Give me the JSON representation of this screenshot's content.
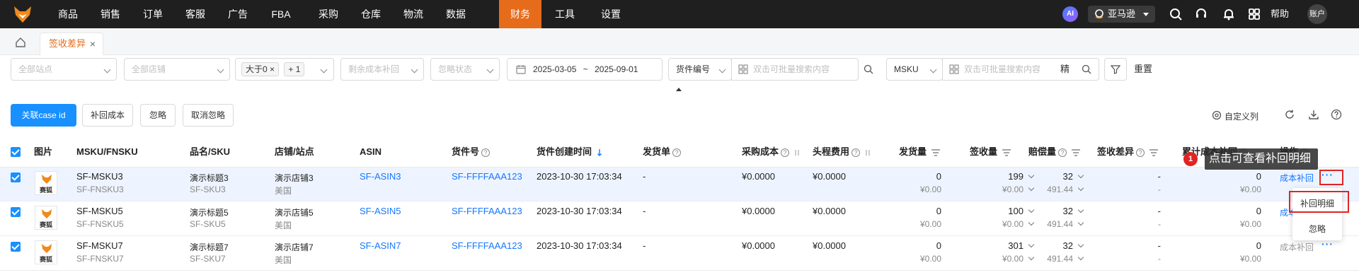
{
  "nav": {
    "items": [
      "商品",
      "销售",
      "订单",
      "客服",
      "广告",
      "FBA",
      "采购",
      "仓库",
      "物流",
      "数据",
      "财务",
      "工具",
      "设置"
    ],
    "active": "财务",
    "ai_label": "AI",
    "marketplace": "亚马逊",
    "help": "帮助",
    "account": "账户",
    "accent": "#e66b1a"
  },
  "tabs": {
    "active_label": "签收差异",
    "close": "×"
  },
  "filters": {
    "site_placeholder": "全部站点",
    "store_placeholder": "全部店铺",
    "tag_gt0": "大于0",
    "tag_plus": "+ 1",
    "remaining_cost_placeholder": "剩余成本补回",
    "ignore_status_placeholder": "忽略状态",
    "date_start": "2025-03-05",
    "date_sep": "~",
    "date_end": "2025-09-01",
    "shipment_select": "货件编号",
    "search1_placeholder": "双击可批量搜索内容",
    "msku_select": "MSKU",
    "search2_placeholder": "双击可批量搜索内容",
    "precise": "精",
    "reset": "重置"
  },
  "actions": {
    "link_case": "关联case id",
    "recover_cost": "补回成本",
    "ignore": "忽略",
    "unignore": "取消忽略",
    "custom_columns": "自定义列"
  },
  "table": {
    "headers": {
      "image": "图片",
      "msku": "MSKU/FNSKU",
      "name_sku": "品名/SKU",
      "store_site": "店铺/站点",
      "asin": "ASIN",
      "shipment_no": "货件号",
      "shipment_created": "货件创建时间",
      "invoice": "发货单",
      "purchase_cost": "采购成本",
      "freight": "头程费用",
      "shipped_qty": "发货量",
      "received_qty": "签收量",
      "compensation_qty": "赔偿量",
      "receive_diff": "签收差异",
      "cumulative_recovered": "累计成本补回",
      "operation": "操作"
    },
    "rows": [
      {
        "thumb_text": "赛狐",
        "msku": "SF-MSKU3",
        "fnsku": "SF-FNSKU3",
        "name": "演示标题3",
        "sku": "SF-SKU3",
        "store": "演示店铺3",
        "site": "美国",
        "asin": "SF-ASIN3",
        "shipment_no": "SF-FFFFAAA123",
        "created": "2023-10-30 17:03:34",
        "invoice": "-",
        "purchase_cost": "¥0.0000",
        "freight": "¥0.0000",
        "shipped": "0",
        "shipped_amt": "¥0.00",
        "received": "199",
        "received_amt": "¥0.00",
        "compensation": "32",
        "compensation_amt": "491.44",
        "diff": "-",
        "diff_sub": "-",
        "cumulative": "0",
        "cumulative_amt": "¥0.00",
        "op": "成本补回",
        "more": "···"
      },
      {
        "thumb_text": "赛狐",
        "msku": "SF-MSKU5",
        "fnsku": "SF-FNSKU5",
        "name": "演示标题5",
        "sku": "SF-SKU5",
        "store": "演示店铺5",
        "site": "美国",
        "asin": "SF-ASIN5",
        "shipment_no": "SF-FFFFAAA123",
        "created": "2023-10-30 17:03:34",
        "invoice": "-",
        "purchase_cost": "¥0.0000",
        "freight": "¥0.0000",
        "shipped": "0",
        "shipped_amt": "¥0.00",
        "received": "100",
        "received_amt": "¥0.00",
        "compensation": "32",
        "compensation_amt": "491.44",
        "diff": "-",
        "diff_sub": "-",
        "cumulative": "0",
        "cumulative_amt": "¥0.00",
        "op": "成本",
        "more": ""
      },
      {
        "thumb_text": "赛狐",
        "msku": "SF-MSKU7",
        "fnsku": "SF-FNSKU7",
        "name": "演示标题7",
        "sku": "SF-SKU7",
        "store": "演示店铺7",
        "site": "美国",
        "asin": "SF-ASIN7",
        "shipment_no": "SF-FFFFAAA123",
        "created": "2023-10-30 17:03:34",
        "invoice": "-",
        "purchase_cost": "¥0.0000",
        "freight": "¥0.0000",
        "shipped": "0",
        "shipped_amt": "¥0.00",
        "received": "301",
        "received_amt": "¥0.00",
        "compensation": "32",
        "compensation_amt": "491.44",
        "diff": "-",
        "diff_sub": "-",
        "cumulative": "0",
        "cumulative_amt": "¥0.00",
        "op": "成本补回",
        "more": "···"
      }
    ]
  },
  "overlay": {
    "badge": "1",
    "tooltip": "点击可查看补回明细",
    "menu_items": [
      "补回明细",
      "忽略"
    ]
  }
}
